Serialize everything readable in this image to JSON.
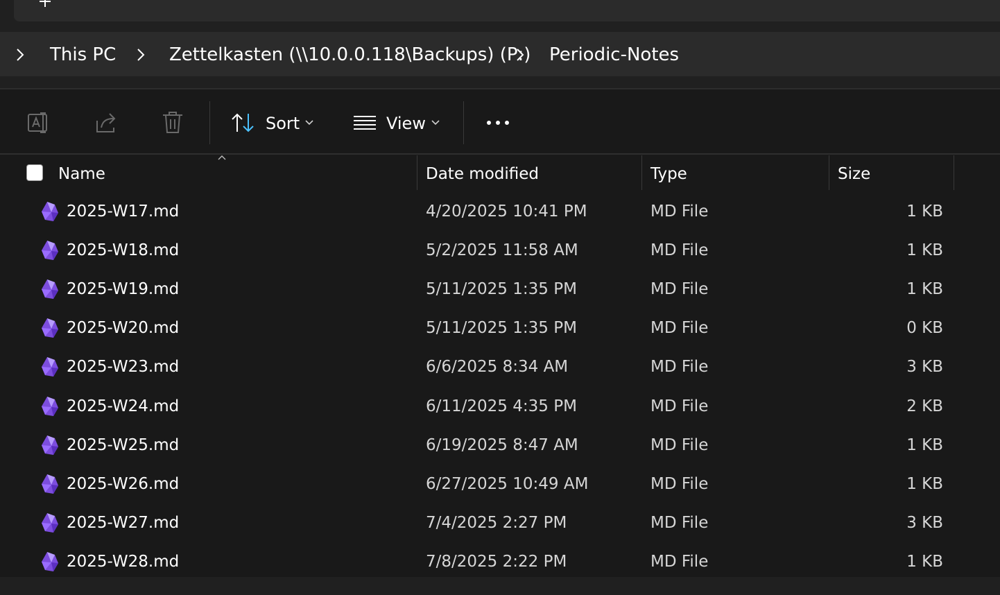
{
  "breadcrumbs": [
    {
      "label": "This PC"
    },
    {
      "label": "Zettelkasten (\\\\10.0.0.118\\Backups) (P:)"
    },
    {
      "label": "Periodic-Notes"
    }
  ],
  "toolbar": {
    "sort_label": "Sort",
    "view_label": "View"
  },
  "columns": {
    "name": "Name",
    "date": "Date modified",
    "type": "Type",
    "size": "Size"
  },
  "files": [
    {
      "name": "2025-W17.md",
      "date": "4/20/2025 10:41 PM",
      "type": "MD File",
      "size": "1 KB"
    },
    {
      "name": "2025-W18.md",
      "date": "5/2/2025 11:58 AM",
      "type": "MD File",
      "size": "1 KB"
    },
    {
      "name": "2025-W19.md",
      "date": "5/11/2025 1:35 PM",
      "type": "MD File",
      "size": "1 KB"
    },
    {
      "name": "2025-W20.md",
      "date": "5/11/2025 1:35 PM",
      "type": "MD File",
      "size": "0 KB"
    },
    {
      "name": "2025-W23.md",
      "date": "6/6/2025 8:34 AM",
      "type": "MD File",
      "size": "3 KB"
    },
    {
      "name": "2025-W24.md",
      "date": "6/11/2025 4:35 PM",
      "type": "MD File",
      "size": "2 KB"
    },
    {
      "name": "2025-W25.md",
      "date": "6/19/2025 8:47 AM",
      "type": "MD File",
      "size": "1 KB"
    },
    {
      "name": "2025-W26.md",
      "date": "6/27/2025 10:49 AM",
      "type": "MD File",
      "size": "1 KB"
    },
    {
      "name": "2025-W27.md",
      "date": "7/4/2025 2:27 PM",
      "type": "MD File",
      "size": "3 KB"
    },
    {
      "name": "2025-W28.md",
      "date": "7/8/2025 2:22 PM",
      "type": "MD File",
      "size": "1 KB"
    }
  ],
  "icons": {
    "file": "obsidian-file-icon",
    "rename": "rename-icon",
    "share": "share-icon",
    "delete": "delete-icon",
    "sort": "sort-arrows-icon",
    "view": "view-list-icon",
    "more": "more-options-icon"
  },
  "colors": {
    "background": "#191919",
    "panel": "#2b2b2b",
    "accent_blue": "#4cc2ff",
    "file_icon": "#8b5cf6"
  }
}
